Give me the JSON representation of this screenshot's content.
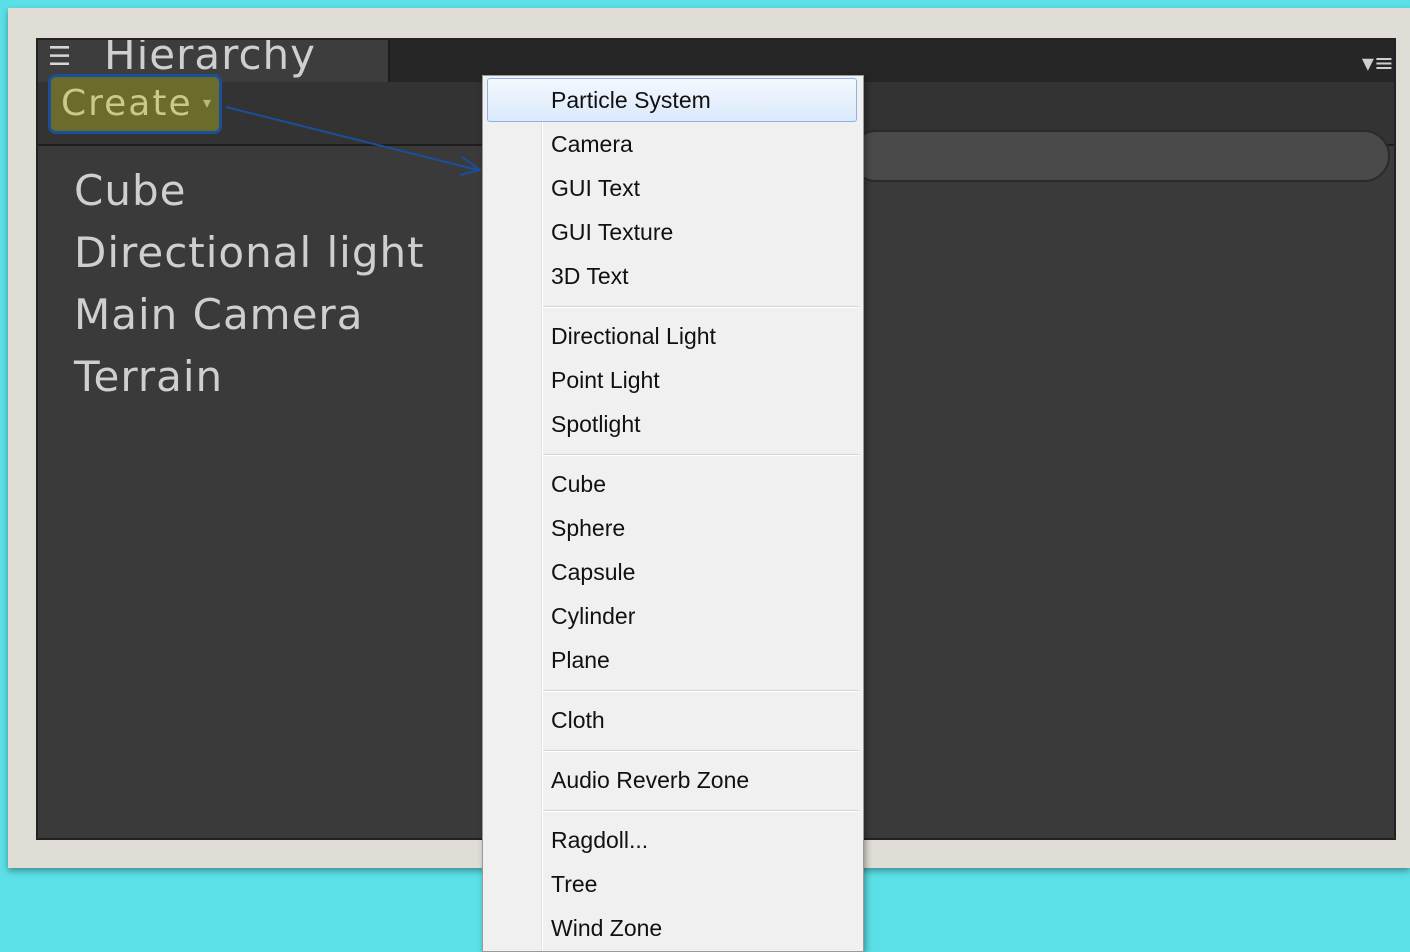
{
  "hierarchy": {
    "tab_title": "Hierarchy",
    "tab_icon": "list-icon",
    "panel_menu_icon": "panel-options-icon",
    "create_label": "Create",
    "create_caret": "▾",
    "items": [
      "Cube",
      "Directional light",
      "Main Camera",
      "Terrain"
    ]
  },
  "menu": {
    "highlighted": "Particle System",
    "groups": [
      [
        "Particle System",
        "Camera",
        "GUI Text",
        "GUI Texture",
        "3D Text"
      ],
      [
        "Directional Light",
        "Point Light",
        "Spotlight"
      ],
      [
        "Cube",
        "Sphere",
        "Capsule",
        "Cylinder",
        "Plane"
      ],
      [
        "Cloth"
      ],
      [
        "Audio Reverb Zone"
      ],
      [
        "Ragdoll...",
        "Tree",
        "Wind Zone"
      ]
    ]
  },
  "colors": {
    "background": "#5ae0e6",
    "panel": "#3a3a3a",
    "create_button": "#6b6b2c",
    "highlight_border": "#1b4f9c",
    "menu_bg": "#f0f0f0"
  }
}
